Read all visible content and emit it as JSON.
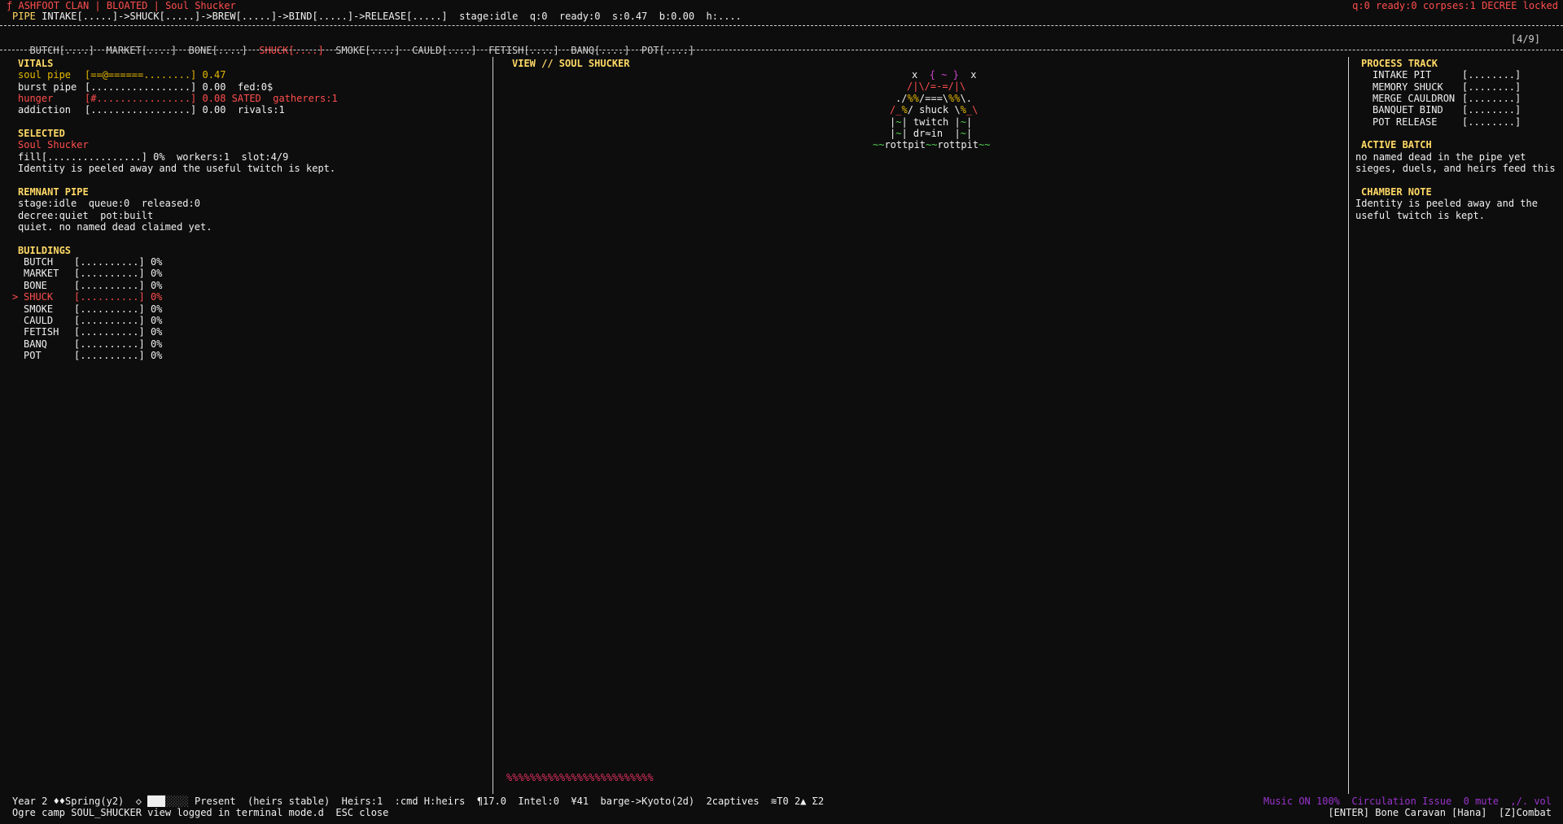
{
  "header": {
    "glyph": "ƒ",
    "title": "ASHFOOT CLAN | BLOATED | Soul Shucker",
    "status_right": "q:0 ready:0 corpses:1 DECREE locked",
    "pipe_label": "PIPE",
    "pipe_text": "INTAKE[.....]->SHUCK[.....]->BREW[.....]->BIND[.....]->RELEASE[.....]  stage:idle  q:0  ready:0  s:0.47  b:0.00  h:...."
  },
  "tabs": {
    "items": [
      {
        "label": "BUTCH[....]"
      },
      {
        "label": "MARKET[....]"
      },
      {
        "label": "BONE[....]"
      },
      {
        "label": "SHUCK[....]"
      },
      {
        "label": "SMOKE[....]"
      },
      {
        "label": "CAULD[....]"
      },
      {
        "label": "FETISH[....]"
      },
      {
        "label": "BANQ[....]"
      },
      {
        "label": "POT[....]"
      }
    ],
    "page": "[4/9]"
  },
  "vitals": {
    "title": "VITALS",
    "rows": [
      {
        "label": "soul pipe",
        "bar": "[==@======........]",
        "value": "0.47",
        "extra": ""
      },
      {
        "label": "burst pipe",
        "bar": "[.................]",
        "value": "0.00",
        "extra": "fed:0$"
      },
      {
        "label": "hunger",
        "bar": "[#................]",
        "value": "0.08",
        "extra": "SATED  gatherers:1"
      },
      {
        "label": "addiction",
        "bar": "[.................]",
        "value": "0.00",
        "extra": "rivals:1"
      }
    ]
  },
  "selected": {
    "title": "SELECTED",
    "name": "Soul Shucker",
    "fill": "fill[................] 0%  workers:1  slot:4/9",
    "desc": "Identity is peeled away and the useful twitch is kept."
  },
  "remnant": {
    "title": "REMNANT PIPE",
    "line1": "stage:idle  queue:0  released:0",
    "line2": "decree:quiet  pot:built",
    "line3": "quiet. no named dead claimed yet."
  },
  "buildings": {
    "title": "BUILDINGS",
    "items": [
      {
        "name": "BUTCH",
        "bar": "[..........]",
        "pct": "0%"
      },
      {
        "name": "MARKET",
        "bar": "[..........]",
        "pct": "0%"
      },
      {
        "name": "BONE",
        "bar": "[..........]",
        "pct": "0%"
      },
      {
        "name": "SHUCK",
        "bar": "[..........]",
        "pct": "0%"
      },
      {
        "name": "SMOKE",
        "bar": "[..........]",
        "pct": "0%"
      },
      {
        "name": "CAULD",
        "bar": "[..........]",
        "pct": "0%"
      },
      {
        "name": "FETISH",
        "bar": "[..........]",
        "pct": "0%"
      },
      {
        "name": "BANQ",
        "bar": "[..........]",
        "pct": "0%"
      },
      {
        "name": "POT",
        "bar": "[..........]",
        "pct": "0%"
      }
    ],
    "selected_marker": ">"
  },
  "view": {
    "title": "VIEW // SOUL SHUCKER",
    "art": {
      "l1a": "x",
      "l1b": "{ ~ }",
      "l1c": "x",
      "l2": "/|\\/=-=/|\\",
      "l3a": "./",
      "l3b": "%%",
      "l3c": "/===\\",
      "l3d": "%%",
      "l3e": "\\.",
      "l4a": "/_",
      "l4b": "%",
      "l4c": "/ shuck \\",
      "l4d": "%",
      "l4e": "_\\",
      "l5a": "|",
      "l5b": "~",
      "l5c": "| twitch |",
      "l5d": "~",
      "l5e": "|",
      "l6a": "|",
      "l6b": "~",
      "l6c": "| dr≈in  |",
      "l6d": "~",
      "l6e": "|",
      "l7a": "~~",
      "l7b": "rottpit",
      "l7c": "~~",
      "l7d": "rottpit",
      "l7e": "~~"
    },
    "gradient": "%%%%%%%%%%%%%%%%%%%%%%%%%"
  },
  "process": {
    "title": "PROCESS TRACK",
    "items": [
      {
        "name": "INTAKE PIT",
        "bar": "[........]"
      },
      {
        "name": "MEMORY SHUCK",
        "bar": "[........]"
      },
      {
        "name": "MERGE CAULDRON",
        "bar": "[........]"
      },
      {
        "name": "BANQUET BIND",
        "bar": "[........]"
      },
      {
        "name": "POT RELEASE",
        "bar": "[........]"
      }
    ]
  },
  "batch": {
    "title": "ACTIVE BATCH",
    "line1": "no named dead in the pipe yet",
    "line2": "sieges, duels, and heirs feed this"
  },
  "chamber": {
    "title": "CHAMBER NOTE",
    "line1": "Identity is peeled away and the",
    "line2": "useful twitch is kept."
  },
  "footer": {
    "year": "Year 2 ♦♦Spring(y2)",
    "diamond": "◇",
    "present": "Present  (heirs stable)  Heirs:1  :cmd H:heirs  ¶17.0  Intel:0  ¥41  barge->Kyoto(2d)  2captives  ≋T0 2▲ Σ2",
    "music": "Music ON 100%  Circulation Issue  0 mute  ,/. vol",
    "log": "Ogre camp SOUL_SHUCKER view logged in terminal mode.d  ESC close",
    "right": "[ENTER] Bone Caravan [Hana]  [Z]Combat"
  },
  "colors": {
    "bg": "#0d0d0d",
    "red": "#ff4d4d",
    "yellow": "#ffd966",
    "gold": "#e6b800",
    "green": "#52d152",
    "magenta": "#cc44cc"
  }
}
